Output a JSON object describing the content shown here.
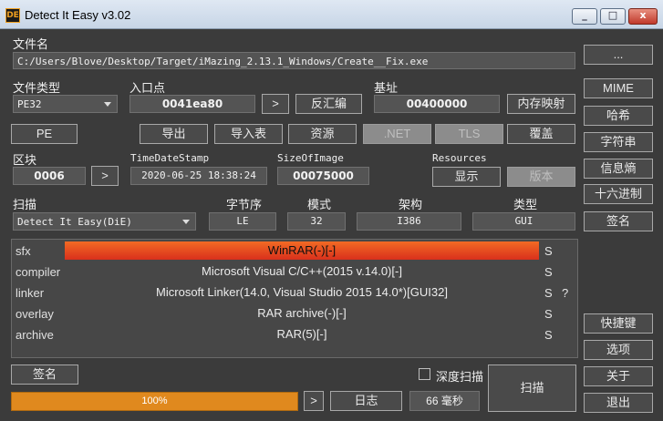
{
  "window": {
    "title": "Detect It Easy v3.02",
    "icon_text": "DE",
    "min": "_",
    "max": "□",
    "close": "x"
  },
  "file": {
    "label": "文件名",
    "path": "C:/Users/Blove/Desktop/Target/iMazing_2.13.1_Windows/Create__Fix.exe",
    "browse": "..."
  },
  "filetype": {
    "label": "文件类型",
    "value": "PE32"
  },
  "entry": {
    "label": "入口点",
    "value": "0041ea80",
    "go": ">",
    "disasm": "反汇编"
  },
  "base": {
    "label": "基址",
    "value": "00400000",
    "memmap": "内存映射"
  },
  "toolbar": {
    "pe": "PE",
    "export": "导出",
    "import": "导入表",
    "resources": "资源",
    "net": ".NET",
    "tls": "TLS",
    "overlay": "覆盖"
  },
  "sections": {
    "label": "区块",
    "value": "0006",
    "go": ">"
  },
  "timestamp": {
    "label": "TimeDateStamp",
    "value": "2020-06-25 18:38:24"
  },
  "sizeofimage": {
    "label": "SizeOfImage",
    "value": "00075000"
  },
  "res": {
    "label": "Resources",
    "show": "显示",
    "version": "版本"
  },
  "scan": {
    "label": "扫描",
    "engine": "Detect It Easy(DiE)"
  },
  "endian": {
    "label": "字节序",
    "value": "LE"
  },
  "mode": {
    "label": "模式",
    "value": "32"
  },
  "arch": {
    "label": "架构",
    "value": "I386"
  },
  "type": {
    "label": "类型",
    "value": "GUI"
  },
  "results": [
    {
      "name": "sfx",
      "value": "WinRAR(-)[-]",
      "s": "S",
      "q": "",
      "highlight": true
    },
    {
      "name": "compiler",
      "value": "Microsoft Visual C/C++(2015 v.14.0)[-]",
      "s": "S",
      "q": ""
    },
    {
      "name": "linker",
      "value": "Microsoft Linker(14.0, Visual Studio 2015 14.0*)[GUI32]",
      "s": "S",
      "q": "?"
    },
    {
      "name": "overlay",
      "value": "RAR archive(-)[-]",
      "s": "S",
      "q": ""
    },
    {
      "name": "archive",
      "value": "RAR(5)[-]",
      "s": "S",
      "q": ""
    }
  ],
  "sidebar": {
    "mime": "MIME",
    "hash": "哈希",
    "strings": "字符串",
    "entropy": "信息熵",
    "hex": "十六进制",
    "signature": "签名",
    "shortcuts": "快捷键",
    "options": "选项",
    "about": "关于",
    "exit": "退出"
  },
  "bottom": {
    "signature": "签名",
    "deep_scan": "深度扫描",
    "scan": "扫描",
    "progress": "100%",
    "progress_value": 1.0,
    "more": ">",
    "log": "日志",
    "time": "66 毫秒"
  }
}
